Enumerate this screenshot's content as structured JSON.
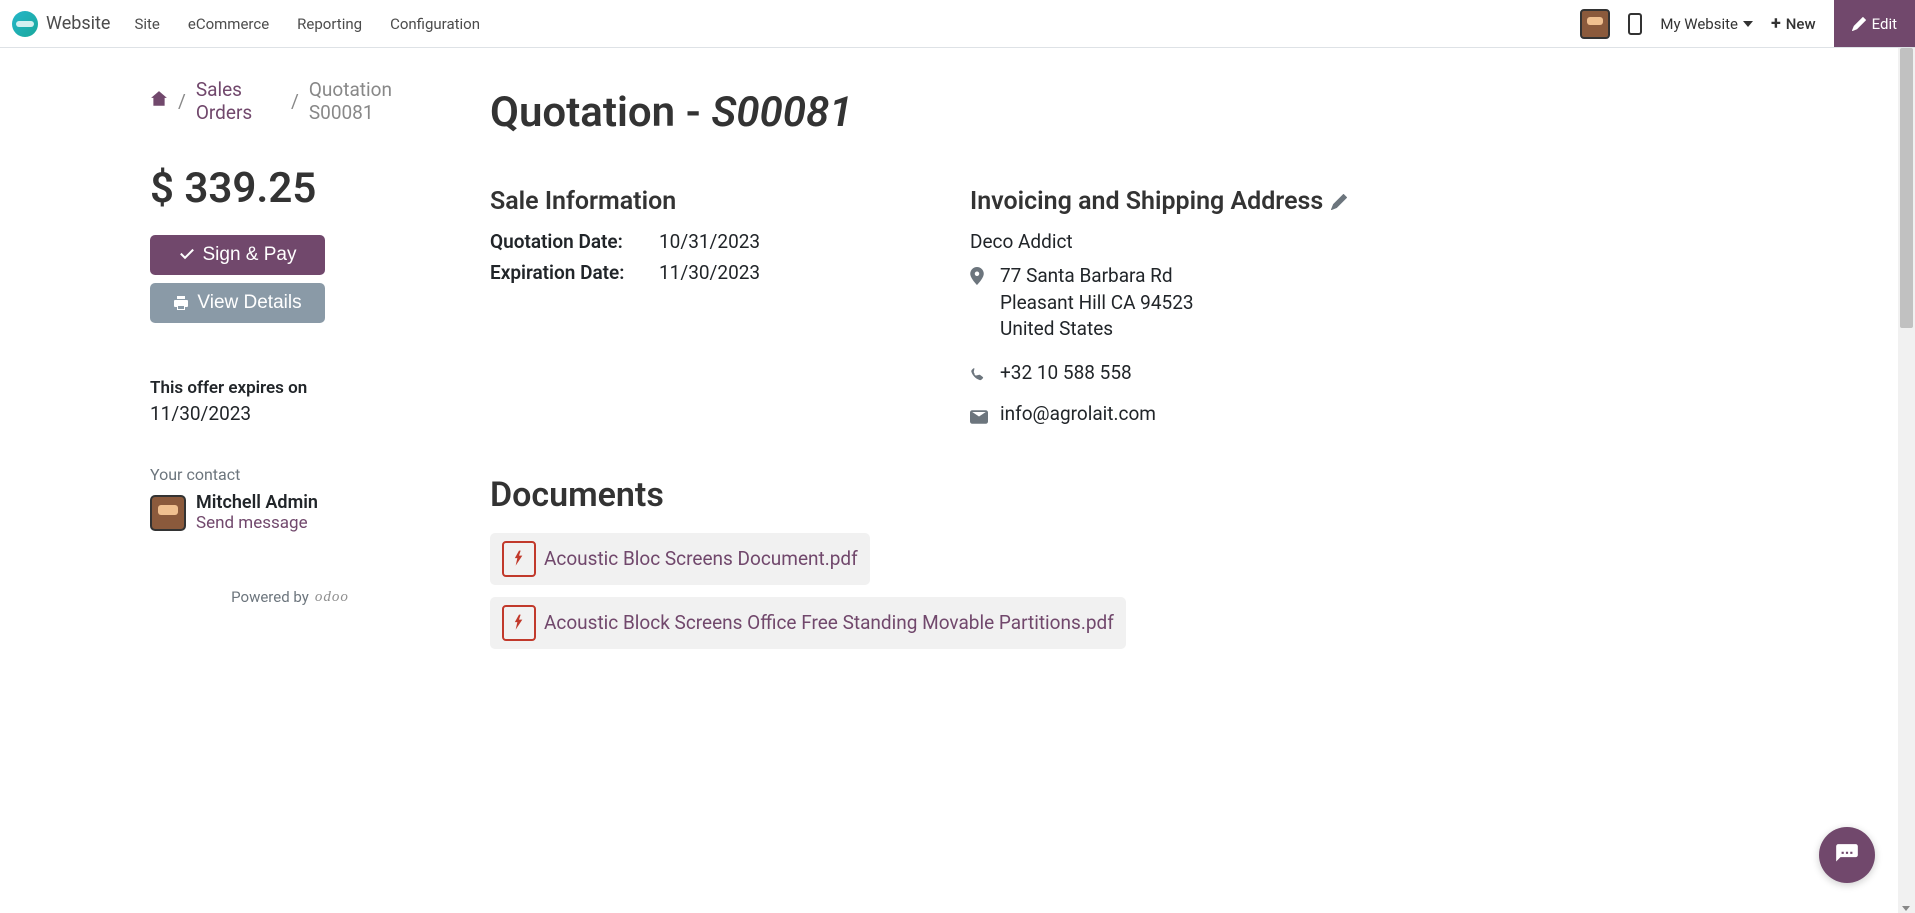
{
  "topbar": {
    "brand": "Website",
    "nav": [
      {
        "label": "Site"
      },
      {
        "label": "eCommerce"
      },
      {
        "label": "Reporting"
      },
      {
        "label": "Configuration"
      }
    ],
    "my_website_label": "My Website",
    "new_label": "New",
    "edit_label": "Edit"
  },
  "breadcrumb": {
    "sales_orders": "Sales Orders",
    "current": "Quotation S00081"
  },
  "sidebar": {
    "price": "$ 339.25",
    "sign_pay_label": "Sign & Pay",
    "view_details_label": "View Details",
    "offer_expires_label": "This offer expires on",
    "offer_expires_date": "11/30/2023",
    "your_contact_label": "Your contact",
    "contact_name": "Mitchell Admin",
    "send_message_label": "Send message",
    "powered_by_label": "Powered by",
    "powered_by_brand": "odoo"
  },
  "main": {
    "title_prefix": "Quotation - ",
    "title_ref": "S00081",
    "sale_info_heading": "Sale Information",
    "quotation_date_label": "Quotation Date:",
    "quotation_date": "10/31/2023",
    "expiration_date_label": "Expiration Date:",
    "expiration_date": "11/30/2023",
    "address_heading": "Invoicing and Shipping Address",
    "address": {
      "company": "Deco Addict",
      "line1": "77 Santa Barbara Rd",
      "line2": "Pleasant Hill CA 94523",
      "country": "United States",
      "phone": "+32 10 588 558",
      "email": "info@agrolait.com"
    },
    "documents_heading": "Documents",
    "documents": [
      {
        "name": "Acoustic Bloc Screens Document.pdf"
      },
      {
        "name": "Acoustic Block Screens Office Free Standing Movable Partitions.pdf"
      }
    ]
  }
}
